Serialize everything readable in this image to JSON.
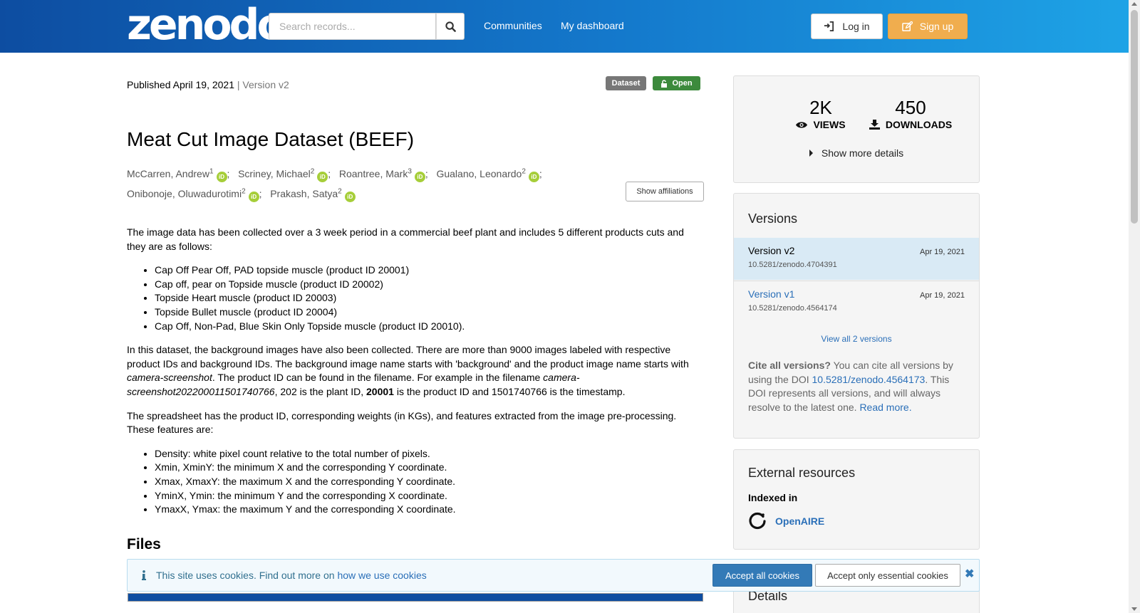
{
  "header": {
    "logo": "zenodo",
    "search_placeholder": "Search records...",
    "nav": [
      "Communities",
      "My dashboard"
    ],
    "login_label": "Log in",
    "signup_label": "Sign up"
  },
  "record": {
    "published": "Published April 19, 2021",
    "version": "Version v2",
    "badge_type": "Dataset",
    "badge_access": "Open",
    "title": "Meat Cut Image Dataset (BEEF)",
    "authors": [
      {
        "name": "McCarren, Andrew",
        "aff": "1"
      },
      {
        "name": "Scriney, Michael",
        "aff": "2"
      },
      {
        "name": "Roantree, Mark",
        "aff": "3"
      },
      {
        "name": "Gualano, Leonardo",
        "aff": "2"
      },
      {
        "name": "Onibonoje, Oluwadurotimi",
        "aff": "2"
      },
      {
        "name": "Prakash, Satya",
        "aff": "2"
      }
    ],
    "orcid_label": "iD",
    "show_affiliations": "Show affiliations"
  },
  "description": {
    "p1": "The image data has been collected over a 3 week period in a commercial beef plant and includes 5 different products cuts and they are as follows:",
    "list1": [
      "Cap Off Pear Off, PAD topside muscle (product ID 20001)",
      "Cap off, pear on Topside muscle (product ID 20002)",
      "Topside Heart muscle (product ID 20003)",
      "Topside Bullet muscle (product ID 20004)",
      "Cap Off, Non-Pad, Blue Skin Only Topside muscle (product ID 20010)."
    ],
    "p2_a": "In this dataset, the background images have also been collected. There are more than 9000 images labeled with respective product IDs and background IDs. The background image name starts with 'background' and the product image name starts with ",
    "p2_em1": "camera-screenshot",
    "p2_b": ". The product ID can be found in the filename. For example in the filename ",
    "p2_em2": "camera-screenshot202200011501740766",
    "p2_c": ", 202 is the plant ID, ",
    "p2_strong": "20001",
    "p2_d": " is the product ID and 1501740766 is the timestamp.",
    "p3": "The spreadsheet has the product ID, corresponding weights (in KGs), and features extracted from the image pre-processing. These features are:",
    "list2": [
      "Density: white pixel count relative to the total number of pixels.",
      "Xmin, XminY: the minimum X and the corresponding Y coordinate.",
      "Xmax, XmaxY: the maximum X and the corresponding Y coordinate.",
      "YminX, Ymin: the minimum Y and the corresponding X coordinate.",
      "YmaxX, Ymax: the maximum Y and the corresponding X coordinate."
    ],
    "files_heading": "Files"
  },
  "stats": {
    "views": "2K",
    "views_label": "VIEWS",
    "downloads": "450",
    "downloads_label": "DOWNLOADS",
    "more_details": "Show more details"
  },
  "versions": {
    "heading": "Versions",
    "items": [
      {
        "name": "Version v2",
        "date": "Apr 19, 2021",
        "doi": "10.5281/zenodo.4704391"
      },
      {
        "name": "Version v1",
        "date": "Apr 19, 2021",
        "doi": "10.5281/zenodo.4564174"
      }
    ],
    "view_all": "View all 2 versions",
    "cite_bold": "Cite all versions?",
    "cite_a": " You can cite all versions by using the DOI ",
    "cite_doi": "10.5281/zenodo.4564173",
    "cite_b": ". This DOI represents all versions, and will always resolve to the latest one. ",
    "read_more": "Read more."
  },
  "external": {
    "heading": "External resources",
    "indexed_in": "Indexed in",
    "openaire": "OpenAIRE"
  },
  "details_heading": "Details",
  "cookie": {
    "text": "This site uses cookies. Find out more on ",
    "link": "how we use cookies",
    "accept_all": "Accept all cookies",
    "accept_essential": "Accept only essential cookies"
  },
  "colors": {
    "header_start": "#0d4da1",
    "header_end": "#1ea3e6",
    "signup": "#f0ad4e",
    "link": "#2a6fb8",
    "open_badge": "#3c8a3c",
    "orcid": "#a6ce39"
  }
}
